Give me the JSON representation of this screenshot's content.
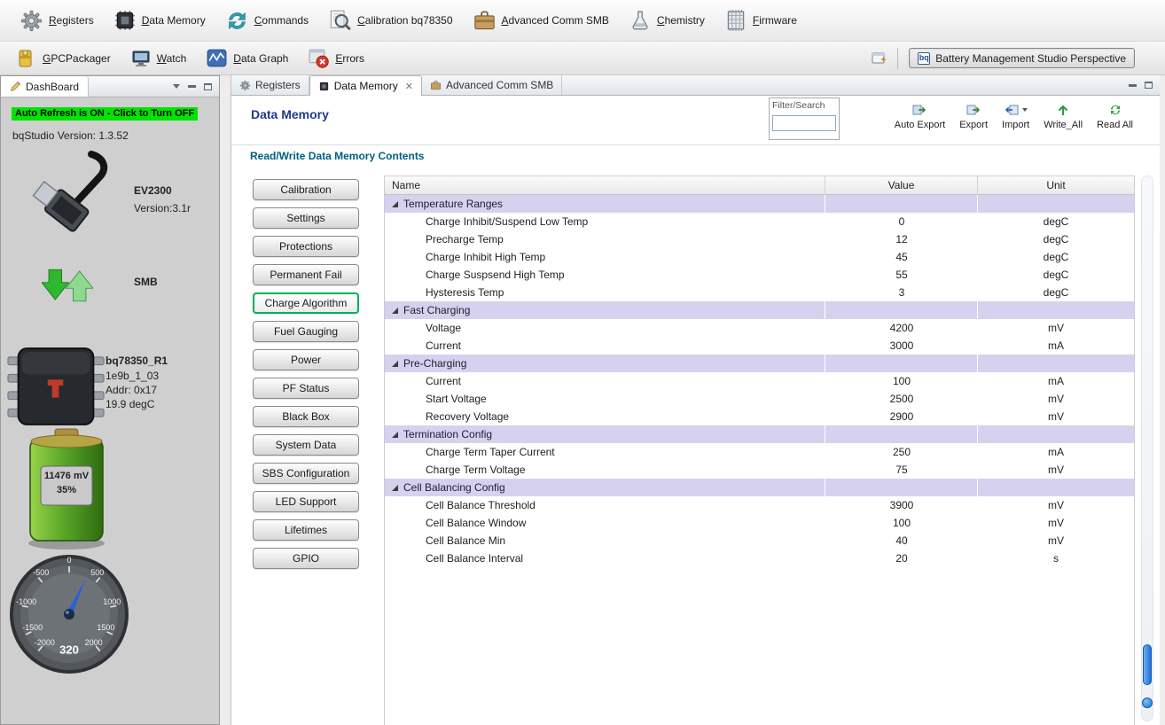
{
  "colors": {
    "accent_green": "#00e400",
    "group_row": "#d7d1f0",
    "title_blue": "#1f3a8f",
    "section_teal": "#00607f",
    "selected_border": "#00b05a",
    "scroll_blue": "#1e6fd9"
  },
  "toolbar": {
    "top": [
      {
        "label": "Registers",
        "icon": "gear-icon"
      },
      {
        "label": "Data Memory",
        "icon": "memory-chip-icon"
      },
      {
        "label": "Commands",
        "icon": "refresh-arrows-icon"
      },
      {
        "label": "Calibration bq78350",
        "icon": "magnifier-icon"
      },
      {
        "label": "Advanced Comm SMB",
        "icon": "toolbox-icon"
      },
      {
        "label": "Chemistry",
        "icon": "flask-icon"
      },
      {
        "label": "Firmware",
        "icon": "firmware-chip-icon"
      }
    ],
    "second": [
      {
        "label": "GPCPackager",
        "icon": "package-icon"
      },
      {
        "label": "Watch",
        "icon": "monitor-icon"
      },
      {
        "label": "Data Graph",
        "icon": "graph-icon"
      },
      {
        "label": "Errors",
        "icon": "error-icon"
      }
    ],
    "perspective_label": "Battery Management Studio Perspective"
  },
  "dashboard": {
    "title": "DashBoard",
    "auto_refresh_banner": "Auto Refresh is ON - Click to Turn OFF",
    "version_line": "bqStudio Version: 1.3.52",
    "adapter": {
      "name": "EV2300",
      "version": "Version:3.1r"
    },
    "bus_label": "SMB",
    "device": {
      "name": "bq78350_R1",
      "firmware": "1e9b_1_03",
      "address": "Addr: 0x17",
      "temperature": "19.9 degC"
    },
    "battery": {
      "voltage": "11476 mV",
      "charge": "35%"
    },
    "gauge": {
      "value": "320",
      "ticks": [
        "0",
        "500",
        "1000",
        "1500",
        "2000",
        "-500",
        "-1000",
        "-1500",
        "-2000"
      ]
    }
  },
  "main": {
    "tabs": [
      {
        "label": "Registers",
        "active": false
      },
      {
        "label": "Data Memory",
        "active": true
      },
      {
        "label": "Advanced Comm SMB",
        "active": false
      }
    ],
    "title": "Data Memory",
    "filter_label": "Filter/Search",
    "actions": {
      "auto_export": "Auto Export",
      "export": "Export",
      "import": "Import",
      "write_all": "Write_All",
      "read_all": "Read All"
    },
    "section_title": "Read/Write Data Memory Contents",
    "categories": [
      "Calibration",
      "Settings",
      "Protections",
      "Permanent Fail",
      "Charge Algorithm",
      "Fuel Gauging",
      "Power",
      "PF Status",
      "Black Box",
      "System Data",
      "SBS Configuration",
      "LED Support",
      "Lifetimes",
      "GPIO"
    ],
    "selected_category": "Charge Algorithm",
    "table": {
      "headers": [
        "Name",
        "Value",
        "Unit"
      ],
      "groups": [
        {
          "name": "Temperature Ranges",
          "rows": [
            {
              "name": "Charge Inhibit/Suspend Low Temp",
              "value": "0",
              "unit": "degC"
            },
            {
              "name": "Precharge Temp",
              "value": "12",
              "unit": "degC"
            },
            {
              "name": "Charge Inhibit High Temp",
              "value": "45",
              "unit": "degC"
            },
            {
              "name": "Charge Suspsend High Temp",
              "value": "55",
              "unit": "degC"
            },
            {
              "name": "Hysteresis Temp",
              "value": "3",
              "unit": "degC"
            }
          ]
        },
        {
          "name": "Fast Charging",
          "rows": [
            {
              "name": "Voltage",
              "value": "4200",
              "unit": "mV"
            },
            {
              "name": "Current",
              "value": "3000",
              "unit": "mA"
            }
          ]
        },
        {
          "name": "Pre-Charging",
          "rows": [
            {
              "name": "Current",
              "value": "100",
              "unit": "mA"
            },
            {
              "name": "Start Voltage",
              "value": "2500",
              "unit": "mV"
            },
            {
              "name": "Recovery Voltage",
              "value": "2900",
              "unit": "mV"
            }
          ]
        },
        {
          "name": "Termination Config",
          "rows": [
            {
              "name": "Charge Term Taper Current",
              "value": "250",
              "unit": "mA"
            },
            {
              "name": "Charge Term Voltage",
              "value": "75",
              "unit": "mV"
            }
          ]
        },
        {
          "name": "Cell Balancing Config",
          "rows": [
            {
              "name": "Cell Balance Threshold",
              "value": "3900",
              "unit": "mV"
            },
            {
              "name": "Cell Balance Window",
              "value": "100",
              "unit": "mV"
            },
            {
              "name": "Cell Balance Min",
              "value": "40",
              "unit": "mV"
            },
            {
              "name": "Cell Balance Interval",
              "value": "20",
              "unit": "s"
            }
          ]
        }
      ]
    }
  }
}
